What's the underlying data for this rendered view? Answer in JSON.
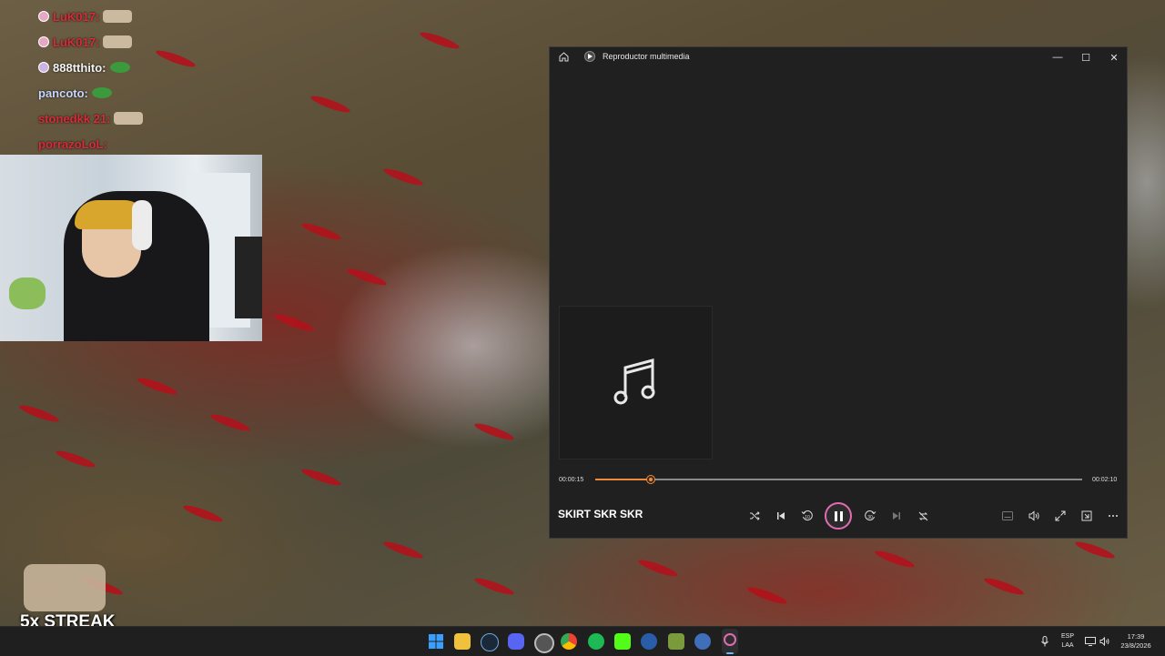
{
  "chat": [
    {
      "user": "LuK017:",
      "color": "#d92b3a"
    },
    {
      "user": "LuK017:",
      "color": "#d92b3a"
    },
    {
      "user": "888tthito:",
      "color": "#f2f2f2"
    },
    {
      "user": "pancoto:",
      "color": "#c9d6ff"
    },
    {
      "user": "stonedkk 21:",
      "color": "#d92b3a"
    },
    {
      "user": "porrazoLoL:",
      "color": "#d92b3a"
    }
  ],
  "overlay": {
    "streak": "5x STREAK"
  },
  "player": {
    "title": "Reproductor multimedia",
    "song": "SKIRT SKR SKR",
    "elapsed": "00:00:15",
    "total": "00:02:10",
    "progress_fraction": 0.114,
    "accent": "#ee8a3c",
    "play_ring": "#e16bb3",
    "state": "playing",
    "window_buttons": {
      "minimize": "—",
      "maximize": "☐",
      "close": "✕"
    },
    "icons": {
      "home": "home-icon",
      "album": "music-note-icon",
      "shuffle": "shuffle-icon",
      "previous": "previous-icon",
      "back10": "rewind-10-icon",
      "pause": "pause-icon",
      "forward30": "forward-30-icon",
      "next": "next-icon",
      "repeat": "repeat-off-icon",
      "captions": "captions-icon",
      "volume": "volume-icon",
      "fullscreen": "fullscreen-icon",
      "miniplayer": "miniplayer-icon",
      "more": "more-icon"
    },
    "skip_back_label": "10",
    "skip_forward_label": "30"
  },
  "taskbar": {
    "apps": [
      "start",
      "file-explorer",
      "steam",
      "discord",
      "chrome-alt",
      "chrome",
      "spotify",
      "kick",
      "ccleaner",
      "minecraft",
      "ccleaner-alt",
      "media-player"
    ],
    "language": "ESP",
    "layout": "LAA",
    "time": "17:39",
    "date": "23/8/2026"
  }
}
